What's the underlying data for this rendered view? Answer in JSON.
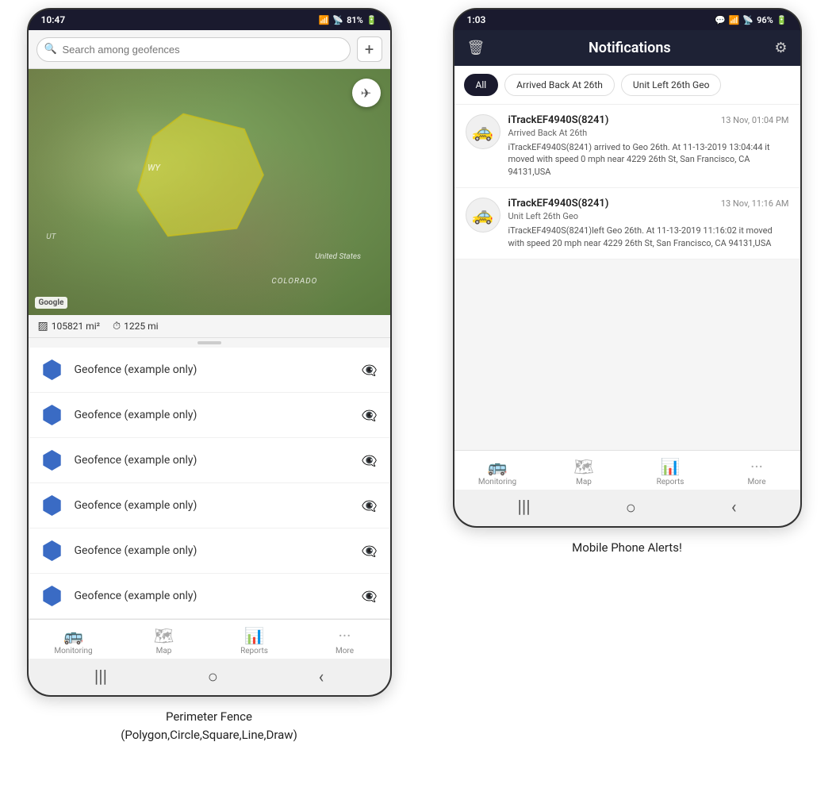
{
  "left_phone": {
    "status": {
      "time": "10:47",
      "signal": "WiFi",
      "battery": "81%"
    },
    "search": {
      "placeholder": "Search among geofences"
    },
    "map": {
      "stat1": "105821 mi²",
      "stat2": "1225 mi",
      "label_wy": "WY",
      "label_us": "United States",
      "label_co": "COLORADO",
      "label_ut": "UT",
      "google": "Google"
    },
    "geofence_items": [
      {
        "name": "Geofence (example only)"
      },
      {
        "name": "Geofence (example only)"
      },
      {
        "name": "Geofence (example only)"
      },
      {
        "name": "Geofence (example only)"
      },
      {
        "name": "Geofence (example only)"
      },
      {
        "name": "Geofence (example only)"
      }
    ],
    "nav": {
      "items": [
        "Monitoring",
        "Map",
        "Reports",
        "More"
      ]
    },
    "caption": "Perimeter Fence\n(Polygon,Circle,Square,Line,Draw)"
  },
  "right_phone": {
    "status": {
      "time": "1:03",
      "battery": "96%"
    },
    "header": {
      "title": "Notifications",
      "delete_icon": "🗑",
      "settings_icon": "⚙"
    },
    "filter_tabs": [
      {
        "label": "All",
        "active": true
      },
      {
        "label": "Arrived Back At 26th",
        "active": false
      },
      {
        "label": "Unit Left 26th Geo",
        "active": false
      }
    ],
    "notifications": [
      {
        "device": "iTrackEF4940S(8241)",
        "time": "13 Nov, 01:04 PM",
        "subtitle": "Arrived Back At 26th",
        "body": "iTrackEF4940S(8241) arrived to Geo 26th.   At 11-13-2019 13:04:44 it moved with speed 0 mph near 4229 26th St, San Francisco, CA 94131,USA"
      },
      {
        "device": "iTrackEF4940S(8241)",
        "time": "13 Nov, 11:16 AM",
        "subtitle": "Unit Left 26th Geo",
        "body": "iTrackEF4940S(8241)left Geo 26th.   At 11-13-2019 11:16:02 it moved with speed 20 mph near 4229 26th St, San Francisco, CA 94131,USA"
      }
    ],
    "nav": {
      "items": [
        "Monitoring",
        "Map",
        "Reports",
        "More"
      ]
    },
    "caption": "Mobile Phone Alerts!"
  }
}
